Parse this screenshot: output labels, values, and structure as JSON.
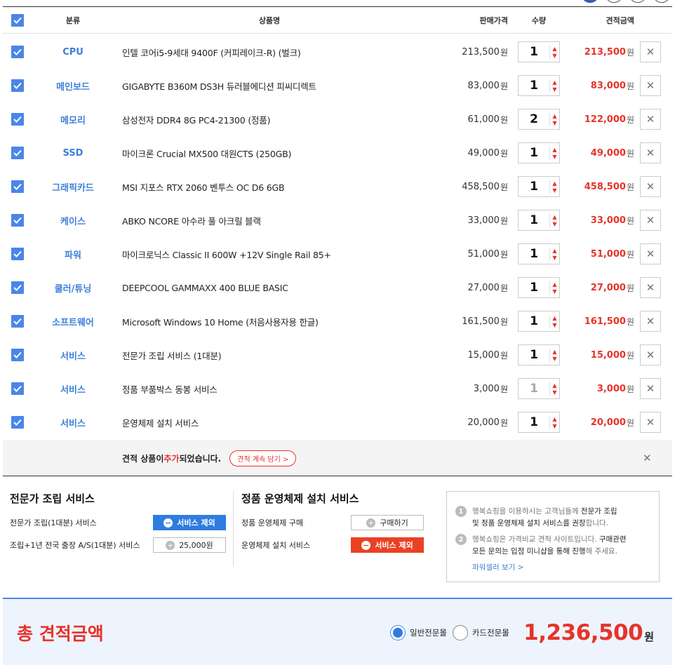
{
  "header": {
    "category": "분류",
    "name": "상품명",
    "price": "판매가격",
    "qty": "수량",
    "total": "견적금액"
  },
  "currency": "원",
  "items": [
    {
      "category": "CPU",
      "name": "인텔 코어i5-9세대 9400F (커피레이크-R) (벌크)",
      "price": "213,500",
      "qty": "1",
      "total": "213,500"
    },
    {
      "category": "메인보드",
      "name": "GIGABYTE B360M DS3H 듀러블에디션 피씨디렉트",
      "price": "83,000",
      "qty": "1",
      "total": "83,000"
    },
    {
      "category": "메모리",
      "name": "삼성전자 DDR4 8G PC4-21300 (정품)",
      "price": "61,000",
      "qty": "2",
      "total": "122,000"
    },
    {
      "category": "SSD",
      "name": "마이크론 Crucial MX500 대원CTS (250GB)",
      "price": "49,000",
      "qty": "1",
      "total": "49,000"
    },
    {
      "category": "그래픽카드",
      "name": "MSI 지포스 RTX 2060 벤투스 OC D6 6GB",
      "price": "458,500",
      "qty": "1",
      "total": "458,500"
    },
    {
      "category": "케이스",
      "name": "ABKO NCORE 아수라 풀 아크릴 블랙",
      "price": "33,000",
      "qty": "1",
      "total": "33,000"
    },
    {
      "category": "파워",
      "name": "마이크로닉스 Classic II 600W +12V Single Rail 85+",
      "price": "51,000",
      "qty": "1",
      "total": "51,000"
    },
    {
      "category": "쿨러/튜닝",
      "name": "DEEPCOOL GAMMAXX 400 BLUE BASIC",
      "price": "27,000",
      "qty": "1",
      "total": "27,000"
    },
    {
      "category": "소프트웨어",
      "name": "Microsoft Windows 10 Home (처음사용자용 한글)",
      "price": "161,500",
      "qty": "1",
      "total": "161,500"
    },
    {
      "category": "서비스",
      "name": "전문가 조립 서비스 (1대분)",
      "price": "15,000",
      "qty": "1",
      "total": "15,000"
    },
    {
      "category": "서비스",
      "name": "정품 부품박스 동봉 서비스",
      "price": "3,000",
      "qty": "1",
      "total": "3,000",
      "qty_disabled": true
    },
    {
      "category": "서비스",
      "name": "운영체제 설치 서비스",
      "price": "20,000",
      "qty": "1",
      "total": "20,000"
    }
  ],
  "notice": {
    "msg_pre": "견적 상품이 ",
    "msg_red": "추가",
    "msg_post": "되었습니다.",
    "button": "견적 계속 담기 >"
  },
  "assembly": {
    "title": "전문가 조립 서비스",
    "line1_label": "전문가 조립(1대분) 서비스",
    "line1_button": "서비스 제외",
    "line2_label": "조립+1년 전국 출장 A/S(1대분) 서비스",
    "line2_button": "25,000원"
  },
  "os_install": {
    "title": "정품 운영체제 설치 서비스",
    "line1_label": "정품 운영체제 구매",
    "line1_button": "구매하기",
    "line2_label": "운영체제 설치 서비스",
    "line2_button": "서비스 제외"
  },
  "info": {
    "item1_num": "1",
    "item1_a": "행복쇼핑을 이용하시는 고객님들께 ",
    "item1_b": "전문가 조립",
    "item1_c": "및 정품 운영체제 설치 서비스를 권장",
    "item1_d": "합니다.",
    "item2_num": "2",
    "item2_a": "행복쇼핑은 가격비교 견적 사이트입니다. ",
    "item2_b": "구매관련",
    "item2_c": "모든 문의는 입점 미니샵을 통해 진행",
    "item2_d": "해 주세요.",
    "link": "파워셀러 보기 >"
  },
  "summary": {
    "title": "총 견적금액",
    "option1": "일반전문몰",
    "option2": "카드전문몰",
    "amount": "1,236,500",
    "unit": "원"
  },
  "colors": {
    "accent_blue": "#4a86e8",
    "price_red": "#e6332a"
  }
}
